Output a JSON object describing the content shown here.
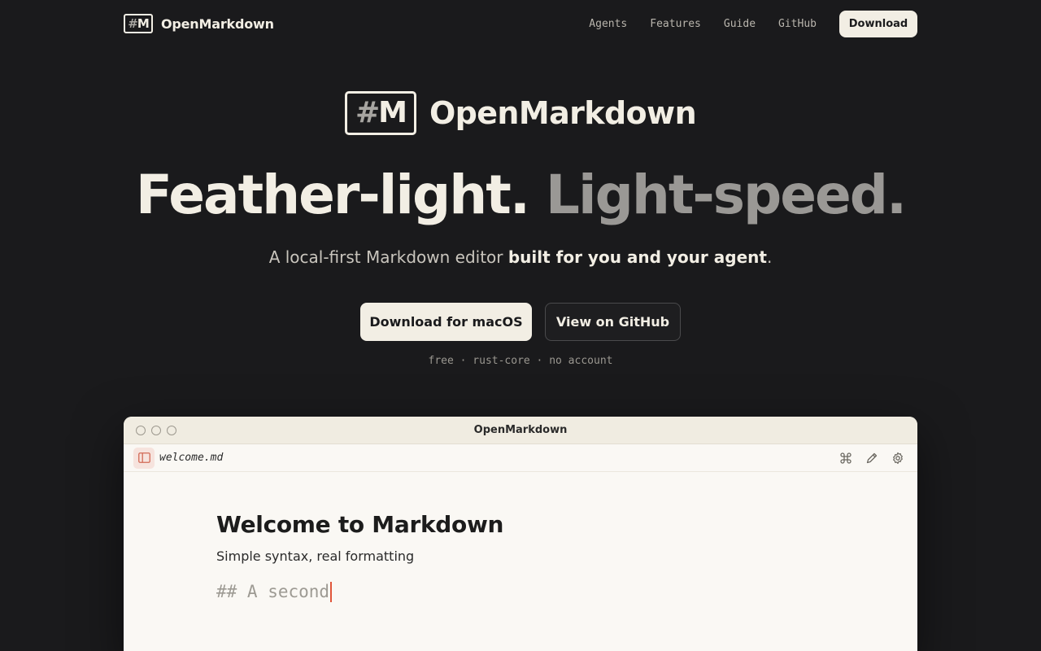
{
  "nav": {
    "logo_hash": "#",
    "logo_letter": "M",
    "brand": "OpenMarkdown",
    "links": [
      "Agents",
      "Features",
      "Guide",
      "GitHub"
    ],
    "download_label": "Download"
  },
  "hero": {
    "logo_hash": "#",
    "logo_letter": "M",
    "brand": "OpenMarkdown",
    "headline_part1": "Feather-light.",
    "headline_part2": "Light-speed.",
    "tagline_plain": "A local-first Markdown editor ",
    "tagline_bold": "built for you and your agent",
    "tagline_end": ".",
    "primary_cta": "Download for macOS",
    "secondary_cta": "View on GitHub",
    "meta": "free · rust-core · no account"
  },
  "app_window": {
    "title": "OpenMarkdown",
    "file_name": "welcome.md",
    "doc_heading": "Welcome to Markdown",
    "doc_paragraph": "Simple syntax, real formatting",
    "doc_typing": "## A second",
    "toolbar_icons": [
      "command-icon",
      "pencil-icon",
      "gear-icon"
    ]
  },
  "colors": {
    "background": "#1a1a1c",
    "cream": "#f2eee4",
    "muted_headline": "#9a9895",
    "caret": "#e0553a",
    "sidebar_toggle_bg": "#f6e3dd"
  }
}
